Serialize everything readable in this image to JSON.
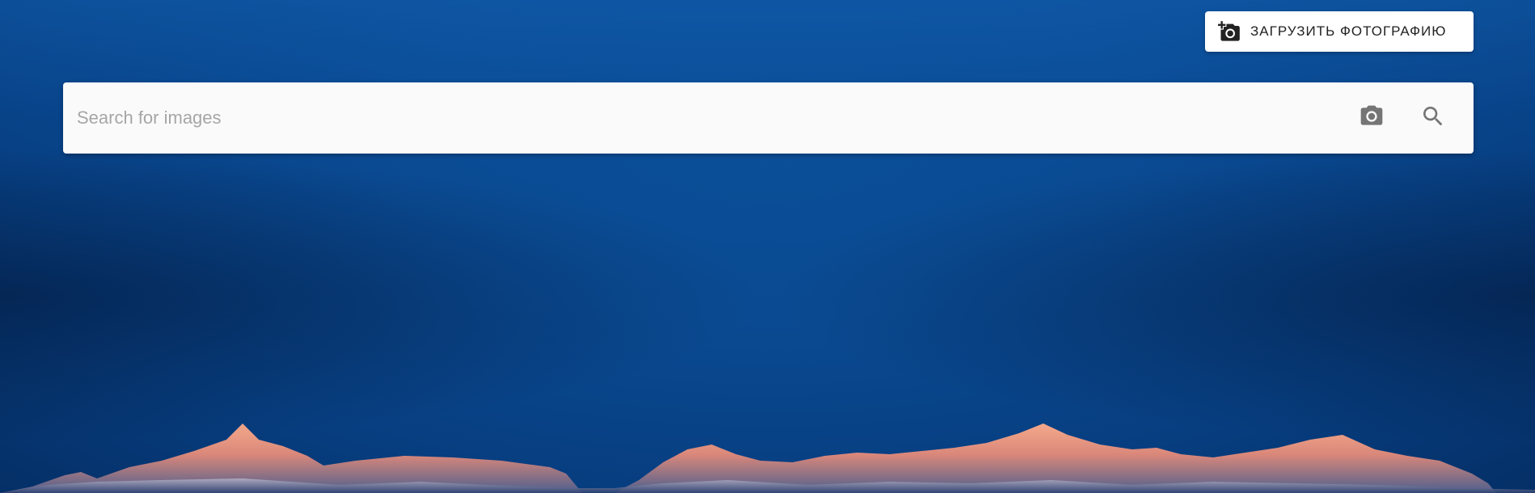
{
  "header": {
    "upload_button_label": "ЗАГРУЗИТЬ ФОТОГРАФИЮ",
    "upload_icon": "add-a-photo-icon"
  },
  "search": {
    "placeholder": "Search for images",
    "value": "",
    "camera_icon": "camera-icon",
    "search_icon": "search-icon"
  },
  "colors": {
    "background": "#0a4a92",
    "surface": "#fafafa",
    "button_bg": "#ffffff",
    "icon": "#757575",
    "placeholder": "#a6a6a6",
    "mountain_glow": "#f0a080"
  }
}
